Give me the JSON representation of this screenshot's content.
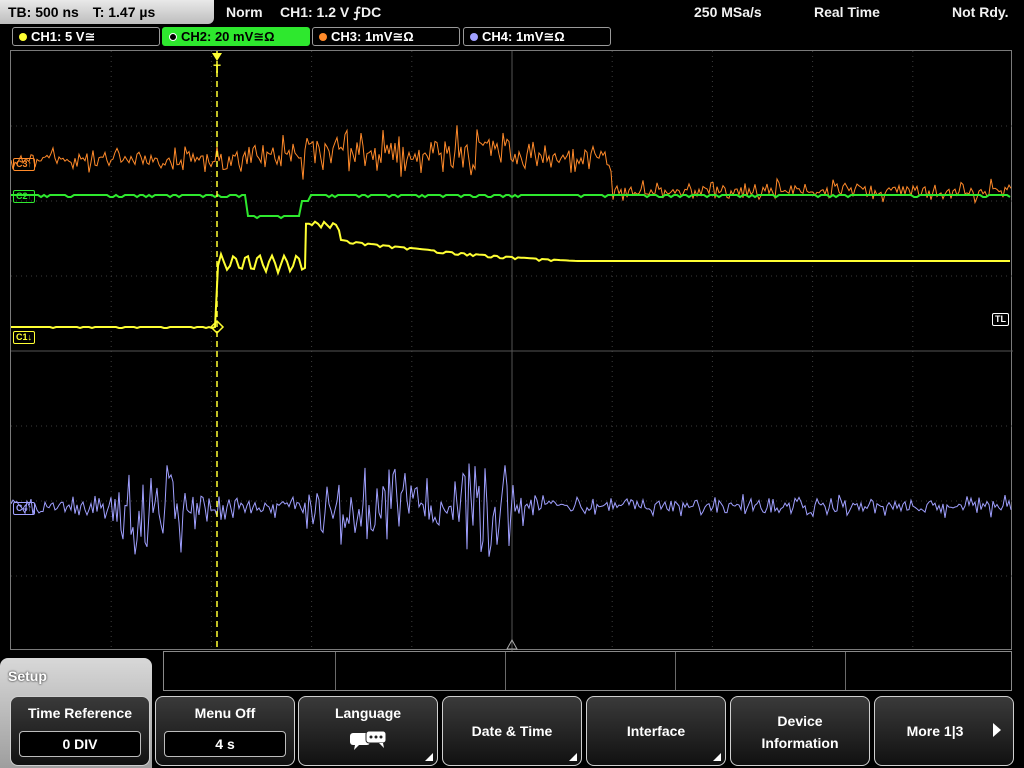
{
  "header": {
    "timebase": "TB: 500 ns",
    "trigger_time": "T: 1.47 µs",
    "mode": "Norm",
    "trigger": "CH1: 1.2 V ⨍DC",
    "sample_rate": "250 MSa/s",
    "acq_mode": "Real Time",
    "status": "Not Rdy."
  },
  "channels": [
    {
      "label": "CH1: 5 V≅",
      "color": "#ffff33"
    },
    {
      "label": "CH2: 20 mV≅Ω",
      "color": "#2ee82e",
      "active": true
    },
    {
      "label": "CH3: 1mV≅Ω",
      "color": "#ff8a2a"
    },
    {
      "label": "CH4: 1mV≅Ω",
      "color": "#a0a0ff"
    }
  ],
  "markers": {
    "ch1": "C1↓",
    "tl": "TL",
    "trigger": "T"
  },
  "menu": {
    "title": "Setup",
    "time_reference": {
      "label": "Time Reference",
      "value": "0 DIV"
    },
    "menu_off": {
      "label": "Menu Off",
      "value": "4 s"
    },
    "language": {
      "label": "Language",
      "icon": "speech-bubbles-icon"
    },
    "date_time": {
      "label": "Date & Time"
    },
    "interface": {
      "label": "Interface"
    },
    "device_info": {
      "line1": "Device",
      "line2": "Information"
    },
    "more": {
      "label": "More 1|3"
    }
  }
}
